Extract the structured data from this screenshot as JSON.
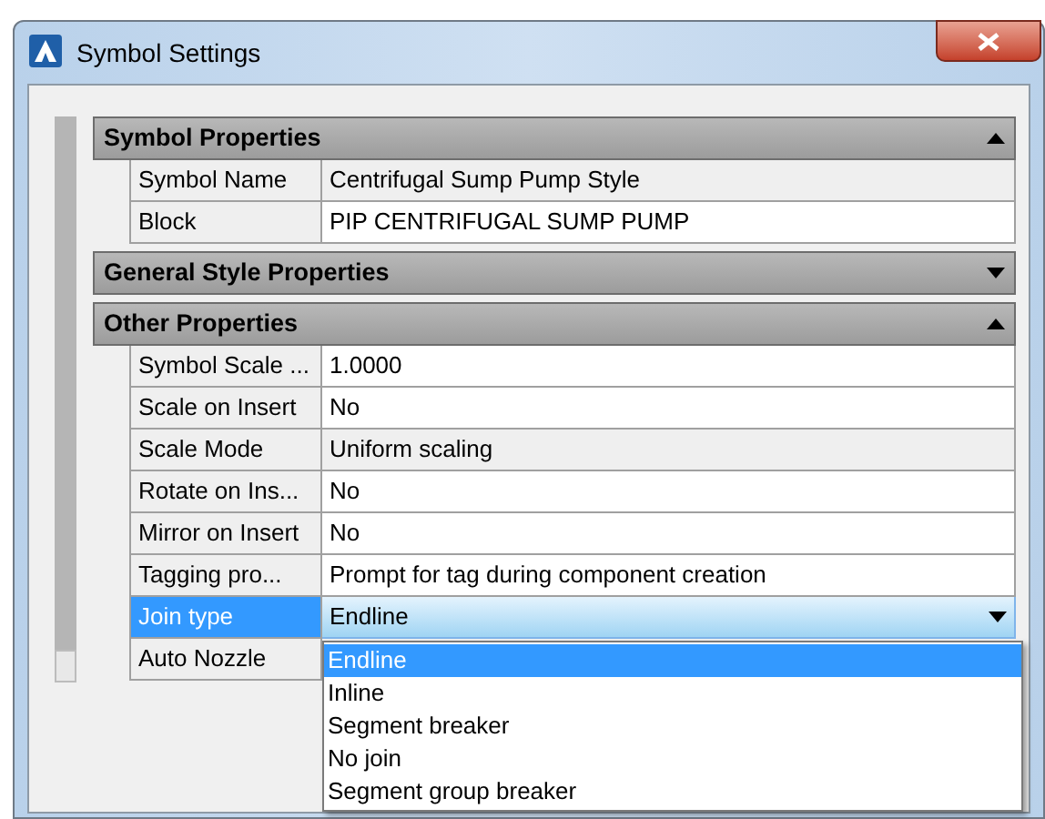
{
  "window": {
    "title": "Symbol Settings"
  },
  "sections": [
    {
      "title": "Symbol Properties",
      "expanded": true,
      "rows": [
        {
          "label": "Symbol Name",
          "value": "Centrifugal Sump Pump Style",
          "readonly": true,
          "selected": false
        },
        {
          "label": "Block",
          "value": "PIP CENTRIFUGAL SUMP PUMP",
          "selected": false
        }
      ]
    },
    {
      "title": "General Style Properties",
      "expanded": false
    },
    {
      "title": "Other Properties",
      "expanded": true,
      "rows": [
        {
          "label": "Symbol Scale ...",
          "value": "1.0000",
          "selected": false
        },
        {
          "label": "Scale on Insert",
          "value": "No",
          "selected": false
        },
        {
          "label": "Scale Mode",
          "value": "Uniform scaling",
          "readonly": true,
          "selected": false
        },
        {
          "label": "Rotate on Ins...",
          "value": "No",
          "selected": false
        },
        {
          "label": "Mirror on Insert",
          "value": "No",
          "selected": false
        },
        {
          "label": "Tagging pro...",
          "value": "Prompt for tag during component creation",
          "selected": false
        },
        {
          "label": "Join type",
          "value": "Endline",
          "selected": true,
          "dropdown": [
            {
              "label": "Endline",
              "selected": true
            },
            {
              "label": "Inline",
              "selected": false
            },
            {
              "label": "Segment breaker",
              "selected": false
            },
            {
              "label": "No join",
              "selected": false
            },
            {
              "label": "Segment group breaker",
              "selected": false
            }
          ]
        },
        {
          "label": "Auto Nozzle",
          "selected": false
        }
      ]
    }
  ]
}
